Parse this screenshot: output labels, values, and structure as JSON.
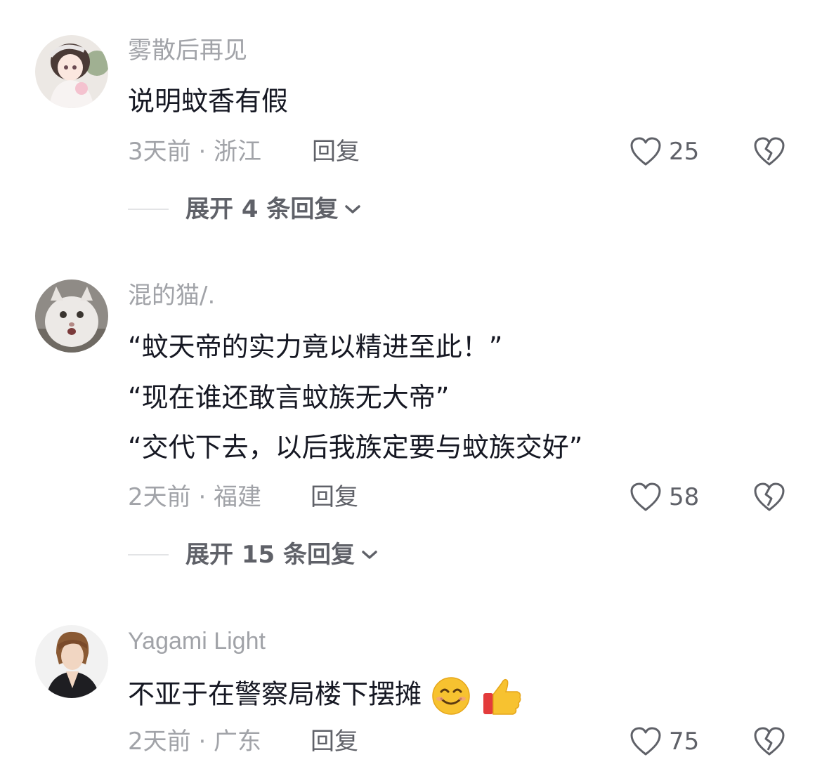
{
  "comments": [
    {
      "username": "雾散后再见",
      "lines": [
        "说明蚊香有假"
      ],
      "meta": "3天前 · 浙江",
      "reply_label": "回复",
      "likes": "25",
      "expand_label": "展开 4 条回复"
    },
    {
      "username": "混的猫/.",
      "lines": [
        "“蚊天帝的实力竟以精进至此！”",
        "“现在谁还敢言蚊族无大帝”",
        "“交代下去，以后我族定要与蚊族交好”"
      ],
      "meta": "2天前 · 福建",
      "reply_label": "回复",
      "likes": "58",
      "expand_label": "展开 15 条回复"
    },
    {
      "username": "Yagami Light",
      "lines": [
        "不亚于在警察局楼下摆摊"
      ],
      "emojis": [
        "smile-emoji",
        "thumbs-up-emoji"
      ],
      "meta": "2天前 · 广东",
      "reply_label": "回复",
      "likes": "75"
    }
  ],
  "icons": {
    "like": "heart-outline-icon",
    "dislike": "broken-heart-icon",
    "expand": "chevron-down-icon"
  },
  "colors": {
    "text_primary": "#161823",
    "text_secondary": "#a1a3a8",
    "text_action": "#5f6168"
  }
}
